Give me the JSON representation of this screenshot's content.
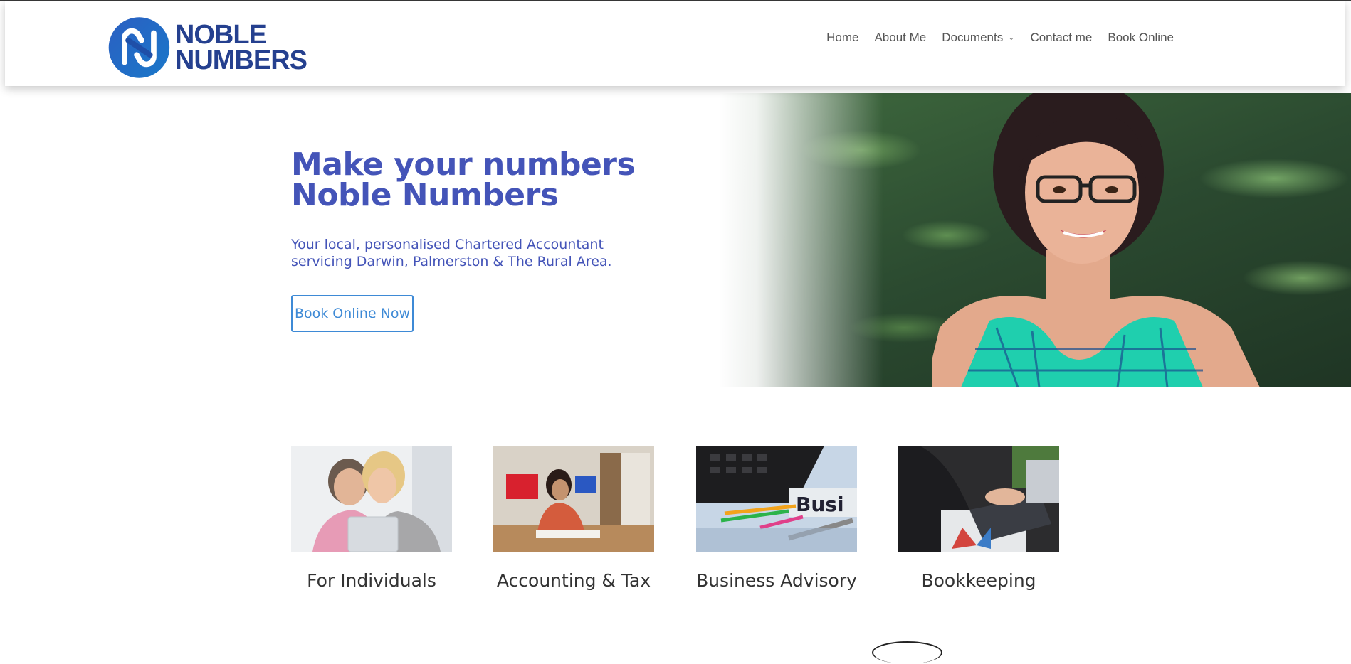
{
  "brand": {
    "name_line1": "NOBLE",
    "name_line2": "NUMBERS",
    "logo_icon": "noble-numbers-knot-logo",
    "color": "#25408f"
  },
  "nav": {
    "items": [
      {
        "label": "Home"
      },
      {
        "label": "About Me"
      },
      {
        "label": "Documents",
        "has_dropdown": true
      },
      {
        "label": "Contact me"
      },
      {
        "label": "Book Online"
      }
    ]
  },
  "hero": {
    "title_line1": "Make your numbers",
    "title_line2": "Noble Numbers",
    "subtitle_line1": "Your local, personalised Chartered Accountant",
    "subtitle_line2": "servicing Darwin, Palmerston & The Rural Area.",
    "cta_label": "Book Online Now",
    "title_color": "#4454b8",
    "cta_color": "#3e8ad6"
  },
  "services": [
    {
      "label": "For Individuals"
    },
    {
      "label": "Accounting & Tax"
    },
    {
      "label": "Business Advisory"
    },
    {
      "label": "Bookkeeping"
    }
  ]
}
